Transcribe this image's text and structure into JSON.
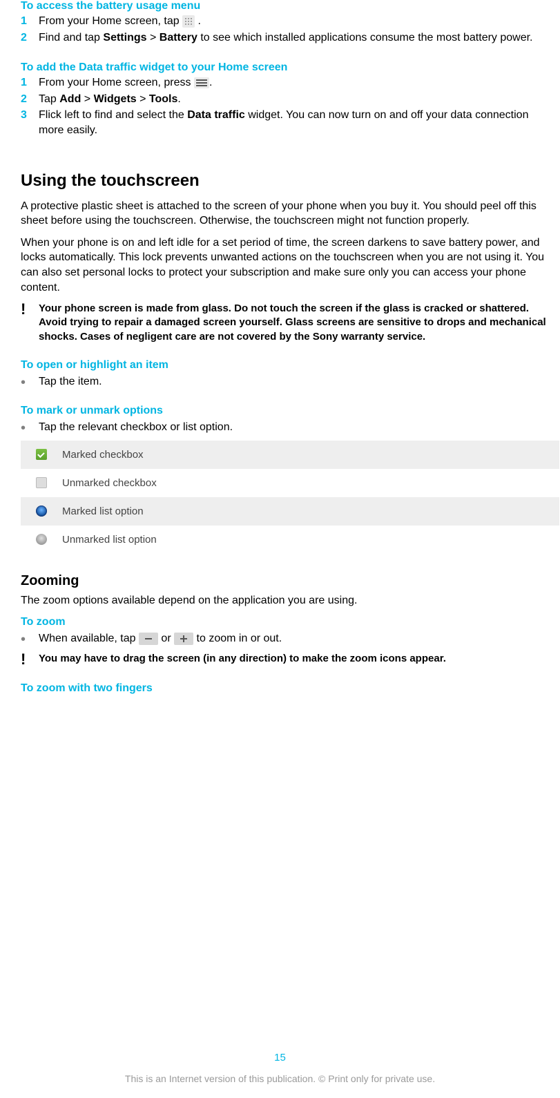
{
  "sec1": {
    "title": "To access the battery usage menu",
    "s1_pre": "From your Home screen, tap ",
    "s1_post": " .",
    "s2_a": "Find and tap ",
    "s2_b": "Settings",
    "s2_c": " > ",
    "s2_d": "Battery",
    "s2_e": " to see which installed applications consume the most battery power."
  },
  "sec2": {
    "title": "To add the Data traffic widget to your Home screen",
    "s1_pre": "From your Home screen, press ",
    "s1_post": ".",
    "s2_a": "Tap ",
    "s2_b": "Add",
    "s2_c": " > ",
    "s2_d": "Widgets",
    "s2_e": " > ",
    "s2_f": "Tools",
    "s2_g": ".",
    "s3_a": "Flick left to find and select the ",
    "s3_b": "Data traffic",
    "s3_c": " widget. You can now turn on and off your data connection more easily."
  },
  "touch": {
    "heading": "Using the touchscreen",
    "p1": "A protective plastic sheet is attached to the screen of your phone when you buy it. You should peel off this sheet before using the touchscreen. Otherwise, the touchscreen might not function properly.",
    "p2": "When your phone is on and left idle for a set period of time, the screen darkens to save battery power, and locks automatically. This lock prevents unwanted actions on the touchscreen when you are not using it. You can also set personal locks to protect your subscription and make sure only you can access your phone content.",
    "warn": "Your phone screen is made from glass. Do not touch the screen if the glass is cracked or shattered. Avoid trying to repair a damaged screen yourself. Glass screens are sensitive to drops and mechanical shocks. Cases of negligent care are not covered by the Sony warranty service."
  },
  "open_item": {
    "title": "To open or highlight an item",
    "b1": "Tap the item."
  },
  "mark": {
    "title": "To mark or unmark options",
    "b1": "Tap the relevant checkbox or list option.",
    "opt1": "Marked checkbox",
    "opt2": "Unmarked checkbox",
    "opt3": "Marked list option",
    "opt4": "Unmarked list option"
  },
  "zoom": {
    "heading": "Zooming",
    "p1": "The zoom options available depend on the application you are using.",
    "title2": "To zoom",
    "b1_a": "When available, tap ",
    "b1_b": " or ",
    "b1_c": " to zoom in or out.",
    "warn": "You may have to drag the screen (in any direction) to make the zoom icons appear.",
    "title3": "To zoom with two fingers"
  },
  "page_number": "15",
  "footer": "This is an Internet version of this publication. © Print only for private use."
}
